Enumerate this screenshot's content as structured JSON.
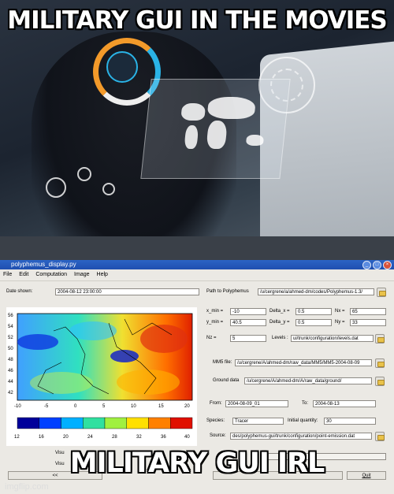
{
  "captions": {
    "top": "MILITARY GUI IN THE MOVIES",
    "bottom": "MILITARY GUI IRL"
  },
  "watermark": "imgflip.com",
  "app": {
    "window_title": "polyphemus_display.py",
    "menu": [
      "File",
      "Edit",
      "Computation",
      "Image",
      "Help"
    ],
    "date_shown_label": "Date shown:",
    "date_shown_value": "2004-08-12 23:00:00",
    "path_label": "Path to Polyphemus",
    "path_value": "/u/cergrene/a/ahmed-dm/codes/Polyphemus-1.3/",
    "x_min_label": "x_min =",
    "x_min_value": "-10",
    "delta_x_label": "Delta_x =",
    "delta_x_value": "0.5",
    "nx_label": "Nx =",
    "nx_value": "65",
    "y_min_label": "y_min =",
    "y_min_value": "40.5",
    "delta_y_label": "Delta_y =",
    "delta_y_value": "0.5",
    "ny_label": "Ny =",
    "ny_value": "33",
    "nz_label": "Nz =",
    "nz_value": "5",
    "levels_label": "Levels :",
    "levels_value": "ui/trunk/configuration/levels.dat",
    "mm5_label": "MM5 file:",
    "mm5_value": "/u/cergrene/A/ahmed-dm/raw_data/MM5/MM5-2004-08-09",
    "ground_label": "Ground data",
    "ground_value": "/u/cergrene/A/ahmed-dm/A/raw_data/ground/",
    "from_label": "From:",
    "from_value": "2004-08-09_01",
    "to_label": "To:",
    "to_value": "2004-08-13",
    "species_label": "Species:",
    "species_value": "Tracer",
    "initial_qty_label": "Initial quantity:",
    "initial_qty_value": "30",
    "source_label": "Source:",
    "source_value": "des/polyphemus-gui/trunk/configuration/point-emission.dat",
    "visu_label_1": "Visu",
    "visu_label_2": "Visu",
    "prev_button": "<<",
    "quit_button": "Quit"
  },
  "plot": {
    "y_ticks": [
      "56",
      "54",
      "52",
      "50",
      "48",
      "46",
      "44",
      "42"
    ],
    "x_ticks": [
      "-10",
      "-5",
      "0",
      "5",
      "10",
      "15",
      "20"
    ],
    "colorbar_ticks": [
      "12",
      "16",
      "20",
      "24",
      "28",
      "32",
      "36",
      "40"
    ],
    "colorbar_colors": [
      "#00009a",
      "#0040ff",
      "#00b0ff",
      "#30e0a0",
      "#a0f040",
      "#ffe000",
      "#ff8000",
      "#e01000"
    ]
  }
}
